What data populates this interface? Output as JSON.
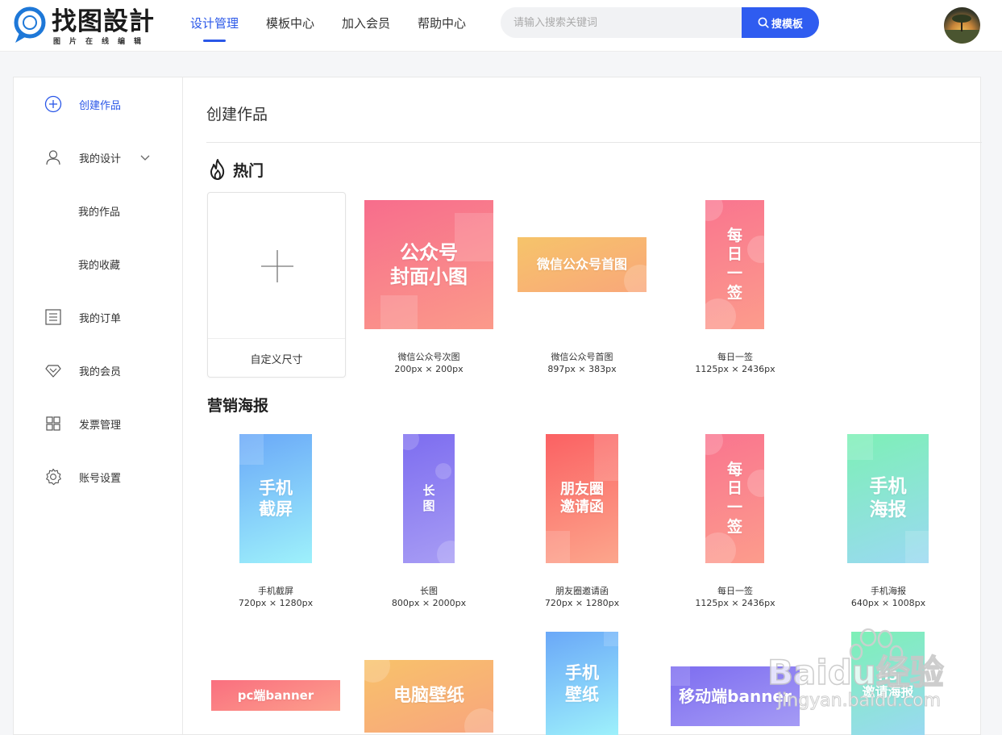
{
  "header": {
    "logo_title": "找图設計",
    "logo_subtitle": "图片在线编辑",
    "nav": [
      {
        "label": "设计管理",
        "active": true
      },
      {
        "label": "模板中心",
        "active": false
      },
      {
        "label": "加入会员",
        "active": false
      },
      {
        "label": "帮助中心",
        "active": false
      }
    ],
    "search": {
      "placeholder": "请输入搜索关键词",
      "value": "",
      "button_label": "搜模板"
    }
  },
  "sidebar": {
    "items": [
      {
        "label": "创建作品",
        "icon": "plus-circle-icon",
        "active": true
      },
      {
        "label": "我的设计",
        "icon": "user-icon",
        "expanded": true
      },
      {
        "label": "我的作品",
        "sub": true
      },
      {
        "label": "我的收藏",
        "sub": true
      },
      {
        "label": "我的订单",
        "icon": "order-list-icon"
      },
      {
        "label": "我的会员",
        "icon": "diamond-icon"
      },
      {
        "label": "发票管理",
        "icon": "grid-icon"
      },
      {
        "label": "账号设置",
        "icon": "gear-icon"
      }
    ]
  },
  "main": {
    "title": "创建作品",
    "hot": {
      "title": "热门",
      "custom_label": "自定义尺寸",
      "items": [
        {
          "name": "微信公众号次图",
          "size": "200px × 200px",
          "thumb_text": "公众号\n封面小图",
          "colors": [
            "#f76d8c",
            "#fb9a8a"
          ]
        },
        {
          "name": "微信公众号首图",
          "size": "897px × 383px",
          "thumb_text": "微信公众号首图",
          "colors": [
            "#f6c46a",
            "#f9a77a"
          ]
        },
        {
          "name": "每日一签",
          "size": "1125px × 2436px",
          "thumb_text": "每\n日\n一\n签",
          "colors": [
            "#f9758f",
            "#fc9c8c"
          ]
        }
      ]
    },
    "marketing": {
      "title": "营销海报",
      "items": [
        {
          "name": "手机截屏",
          "size": "720px × 1280px",
          "thumb_text": "手机\n截屏",
          "colors": [
            "#6aa8f8",
            "#9ef1fb"
          ]
        },
        {
          "name": "长图",
          "size": "800px × 2000px",
          "thumb_text": "长\n图",
          "colors": [
            "#7d6df0",
            "#a79cf4"
          ]
        },
        {
          "name": "朋友圈邀请函",
          "size": "720px × 1280px",
          "thumb_text": "朋友圈\n邀请函",
          "colors": [
            "#fb6163",
            "#fca68c"
          ]
        },
        {
          "name": "每日一签",
          "size": "1125px × 2436px",
          "thumb_text": "每\n日\n一\n签",
          "colors": [
            "#f9758f",
            "#fc9c8c"
          ]
        },
        {
          "name": "手机海报",
          "size": "640px × 1008px",
          "thumb_text": "手机\n海报",
          "colors": [
            "#7df0b6",
            "#9ad9f2"
          ]
        }
      ]
    },
    "row3": [
      {
        "thumb_text": "pc端banner",
        "colors": [
          "#fa6f7f",
          "#fc9f8c"
        ]
      },
      {
        "thumb_text": "电脑壁纸",
        "colors": [
          "#f8c26a",
          "#f8a57e"
        ]
      },
      {
        "thumb_text": "手机\n壁纸",
        "colors": [
          "#6aa8f8",
          "#9ef1fb"
        ]
      },
      {
        "thumb_text": "移动端banner",
        "colors": [
          "#7d6df0",
          "#a59bf5"
        ]
      },
      {
        "thumb_text": "H5\n邀请海报",
        "colors": [
          "#7df0b6",
          "#9ad9f2"
        ]
      }
    ]
  },
  "watermark": {
    "text": "Baidu经验",
    "url_text": "jingyan.baidu.com"
  }
}
